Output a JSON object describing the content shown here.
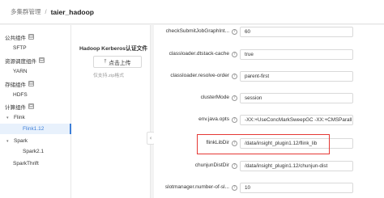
{
  "header": {
    "breadcrumb_root": "多集群管理",
    "breadcrumb_separator": "/",
    "breadcrumb_current": "taier_hadoop"
  },
  "sidebar": {
    "items": [
      {
        "label": "公共组件",
        "type": "group",
        "expand": "⊟"
      },
      {
        "label": "SFTP",
        "type": "item"
      },
      {
        "label": "资源调度组件",
        "type": "group",
        "expand": "⊟"
      },
      {
        "label": "YARN",
        "type": "item"
      },
      {
        "label": "存储组件",
        "type": "group",
        "expand": "⊟"
      },
      {
        "label": "HDFS",
        "type": "item"
      },
      {
        "label": "计算组件",
        "type": "group",
        "expand": "⊟"
      },
      {
        "label": "Flink",
        "type": "folder",
        "caret": "▾"
      },
      {
        "label": "Flink1.12",
        "type": "subitem",
        "active": true
      },
      {
        "label": "Spark",
        "type": "folder",
        "caret": "▾"
      },
      {
        "label": "Spark2.1",
        "type": "subitem"
      },
      {
        "label": "SparkThrift",
        "type": "item"
      }
    ]
  },
  "kerberos": {
    "title": "Hadoop Kerberos认证文件",
    "upload_label": "点击上传",
    "hint": "仅支持.zip格式"
  },
  "form": {
    "rows": [
      {
        "label": "checkSubmitJobGraphInt...",
        "value": "60"
      },
      {
        "label": "classloader.dtstack-cache",
        "value": "true"
      },
      {
        "label": "classloader.resolve-order",
        "value": "parent-first"
      },
      {
        "label": "clusterMode",
        "value": "session"
      },
      {
        "label": "env.java.opts",
        "value": "-XX:+UseConcMarkSweepGC -XX:+CMSParall"
      },
      {
        "label": "flinkLibDir",
        "value": "/data/insight_plugin1.12/flink_lib"
      },
      {
        "label": "chunjunDistDir",
        "value": "/data/insight_plugin1.12/chunjun-dist"
      },
      {
        "label": "slotmanager.number-of-sl...",
        "value": "10"
      }
    ]
  },
  "icons": {
    "help": "?",
    "upload": "upload-icon",
    "collapse": "‹"
  },
  "colors": {
    "active": "#3d7fd8",
    "highlight": "#e53935"
  }
}
